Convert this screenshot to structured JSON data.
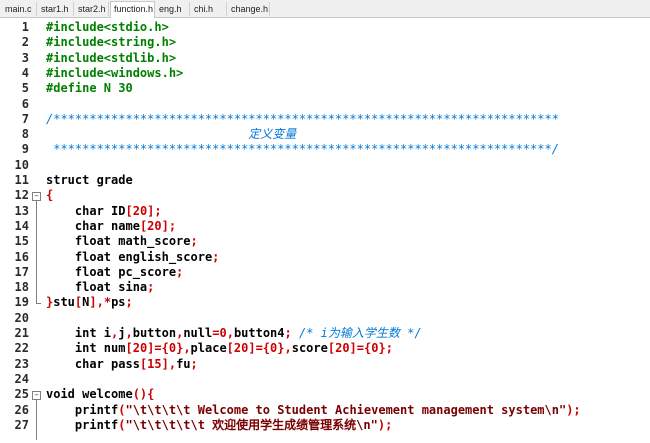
{
  "tabs": [
    {
      "label": "main.c"
    },
    {
      "label": "star1.h"
    },
    {
      "label": "star2.h"
    },
    {
      "label": "function.h"
    },
    {
      "label": "eng.h"
    },
    {
      "label": "chi.h"
    },
    {
      "label": "change.h"
    }
  ],
  "active_tab": 3,
  "lines": [
    {
      "n": "1",
      "segs": [
        [
          "pp",
          "#include<stdio.h>"
        ]
      ]
    },
    {
      "n": "2",
      "segs": [
        [
          "pp",
          "#include<string.h>"
        ]
      ]
    },
    {
      "n": "3",
      "segs": [
        [
          "pp",
          "#include<stdlib.h>"
        ]
      ]
    },
    {
      "n": "4",
      "segs": [
        [
          "pp",
          "#include<windows.h>"
        ]
      ]
    },
    {
      "n": "5",
      "segs": [
        [
          "pp",
          "#define N 30"
        ]
      ]
    },
    {
      "n": "6",
      "segs": []
    },
    {
      "n": "7",
      "segs": [
        [
          "cm",
          "/**********************************************************************"
        ]
      ]
    },
    {
      "n": "8",
      "segs": [
        [
          "cm",
          "                            定义变量"
        ]
      ]
    },
    {
      "n": "9",
      "segs": [
        [
          "cm",
          " *********************************************************************/"
        ]
      ]
    },
    {
      "n": "10",
      "segs": []
    },
    {
      "n": "11",
      "segs": [
        [
          "kw",
          "struct grade"
        ]
      ]
    },
    {
      "n": "12",
      "segs": [
        [
          "op",
          "{"
        ]
      ]
    },
    {
      "n": "13",
      "segs": [
        [
          "kw",
          "    char "
        ],
        [
          "kw",
          "ID"
        ],
        [
          "op",
          "["
        ],
        [
          "num",
          "20"
        ],
        [
          "op",
          "];"
        ]
      ]
    },
    {
      "n": "14",
      "segs": [
        [
          "kw",
          "    char "
        ],
        [
          "kw",
          "name"
        ],
        [
          "op",
          "["
        ],
        [
          "num",
          "20"
        ],
        [
          "op",
          "];"
        ]
      ]
    },
    {
      "n": "15",
      "segs": [
        [
          "kw",
          "    float "
        ],
        [
          "kw",
          "math_score"
        ],
        [
          "op",
          ";"
        ]
      ]
    },
    {
      "n": "16",
      "segs": [
        [
          "kw",
          "    float "
        ],
        [
          "kw",
          "english_score"
        ],
        [
          "op",
          ";"
        ]
      ]
    },
    {
      "n": "17",
      "segs": [
        [
          "kw",
          "    float "
        ],
        [
          "kw",
          "pc_score"
        ],
        [
          "op",
          ";"
        ]
      ]
    },
    {
      "n": "18",
      "segs": [
        [
          "kw",
          "    float "
        ],
        [
          "kw",
          "sina"
        ],
        [
          "op",
          ";"
        ]
      ]
    },
    {
      "n": "19",
      "segs": [
        [
          "op",
          "}"
        ],
        [
          "kw",
          "stu"
        ],
        [
          "op",
          "["
        ],
        [
          "kw",
          "N"
        ],
        [
          "op",
          "],*"
        ],
        [
          "kw",
          "ps"
        ],
        [
          "op",
          ";"
        ]
      ]
    },
    {
      "n": "20",
      "segs": []
    },
    {
      "n": "21",
      "segs": [
        [
          "kw",
          "    int "
        ],
        [
          "kw",
          "i"
        ],
        [
          "op",
          ","
        ],
        [
          "kw",
          "j"
        ],
        [
          "op",
          ","
        ],
        [
          "kw",
          "button"
        ],
        [
          "op",
          ","
        ],
        [
          "kw",
          "null"
        ],
        [
          "op",
          "="
        ],
        [
          "num",
          "0"
        ],
        [
          "op",
          ","
        ],
        [
          "kw",
          "button4"
        ],
        [
          "op",
          "; "
        ],
        [
          "cm",
          "/* i为输入学生数 */"
        ]
      ]
    },
    {
      "n": "22",
      "segs": [
        [
          "kw",
          "    int "
        ],
        [
          "kw",
          "num"
        ],
        [
          "op",
          "["
        ],
        [
          "num",
          "20"
        ],
        [
          "op",
          "]={"
        ],
        [
          "num",
          "0"
        ],
        [
          "op",
          "},"
        ],
        [
          "kw",
          "place"
        ],
        [
          "op",
          "["
        ],
        [
          "num",
          "20"
        ],
        [
          "op",
          "]={"
        ],
        [
          "num",
          "0"
        ],
        [
          "op",
          "},"
        ],
        [
          "kw",
          "score"
        ],
        [
          "op",
          "["
        ],
        [
          "num",
          "20"
        ],
        [
          "op",
          "]={"
        ],
        [
          "num",
          "0"
        ],
        [
          "op",
          "};"
        ]
      ]
    },
    {
      "n": "23",
      "segs": [
        [
          "kw",
          "    char "
        ],
        [
          "kw",
          "pass"
        ],
        [
          "op",
          "["
        ],
        [
          "num",
          "15"
        ],
        [
          "op",
          "],"
        ],
        [
          "kw",
          "fu"
        ],
        [
          "op",
          ";"
        ]
      ]
    },
    {
      "n": "24",
      "segs": []
    },
    {
      "n": "25",
      "segs": [
        [
          "kw",
          "void "
        ],
        [
          "kw",
          "welcome"
        ],
        [
          "op",
          "(){"
        ]
      ]
    },
    {
      "n": "26",
      "segs": [
        [
          "kw",
          "    printf"
        ],
        [
          "op",
          "("
        ],
        [
          "st",
          "\"\\t\\t\\t\\t Welcome to Student Achievement management system\\n\""
        ],
        [
          "op",
          ");"
        ]
      ]
    },
    {
      "n": "27",
      "segs": [
        [
          "kw",
          "    printf"
        ],
        [
          "op",
          "("
        ],
        [
          "st",
          "\"\\t\\t\\t\\t\\t 欢迎使用学生成绩管理系统\\n\""
        ],
        [
          "op",
          ");"
        ]
      ]
    }
  ],
  "folds": [
    {
      "line": "12",
      "symbol": "−"
    },
    {
      "line": "25",
      "symbol": "−"
    }
  ]
}
